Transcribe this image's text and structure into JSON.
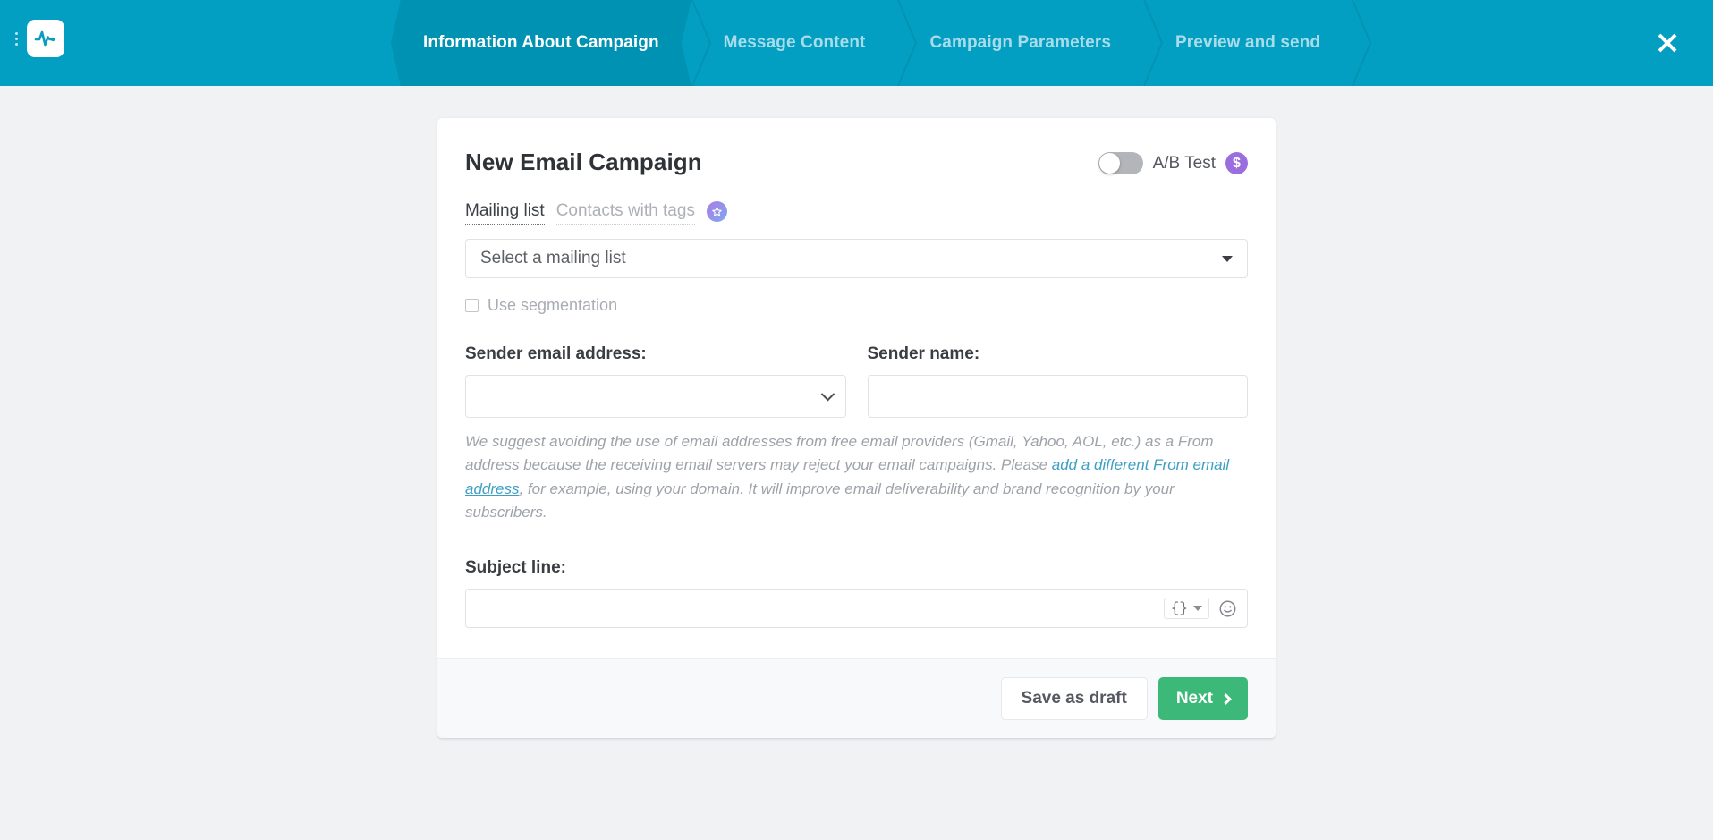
{
  "header": {
    "brand_icon": "pulse-logo-icon",
    "menu_icon": "kebab-menu-icon",
    "close_icon": "close-icon",
    "bg_color": "#039fc2",
    "active_tab_color": "#0092b3",
    "tabs": [
      {
        "label": "Information About Campaign",
        "active": true
      },
      {
        "label": "Message Content",
        "active": false
      },
      {
        "label": "Campaign Parameters",
        "active": false
      },
      {
        "label": "Preview and send",
        "active": false
      }
    ]
  },
  "card": {
    "title": "New Email Campaign",
    "ab_test": {
      "label": "A/B Test",
      "toggle_state": "off",
      "badge": "$",
      "badge_color": "#9b6ee0"
    },
    "audience_tabs": [
      {
        "label": "Mailing list",
        "active": true
      },
      {
        "label": "Contacts with tags",
        "active": false,
        "badge_icon": "star-icon"
      }
    ],
    "mailing_list": {
      "value": "Select a mailing list",
      "caret_icon": "caret-down-icon"
    },
    "segmentation": {
      "label": "Use segmentation",
      "checked": false,
      "disabled": true
    },
    "sender_email": {
      "label": "Sender email address:",
      "value": "",
      "caret_icon": "chevron-down-icon"
    },
    "sender_name": {
      "label": "Sender name:",
      "value": ""
    },
    "help_text": {
      "part1": "We suggest avoiding the use of email addresses from free email providers (Gmail, Yahoo, AOL, etc.) as a From address because the receiving email servers may reject your email campaigns. Please ",
      "link": "add a different From email address",
      "part2": ", for example, using your domain. It will improve email deliverability and brand recognition by your subscribers.",
      "link_color": "#3e9fc4"
    },
    "subject": {
      "label": "Subject line:",
      "value": "",
      "merge_tag_icon": "braces-icon",
      "merge_tag_caret_icon": "caret-down-icon",
      "emoji_icon": "smiley-icon"
    },
    "footer": {
      "save_label": "Save as draft",
      "next_label": "Next",
      "next_icon": "chevron-right-icon",
      "next_color": "#3cb878"
    }
  }
}
